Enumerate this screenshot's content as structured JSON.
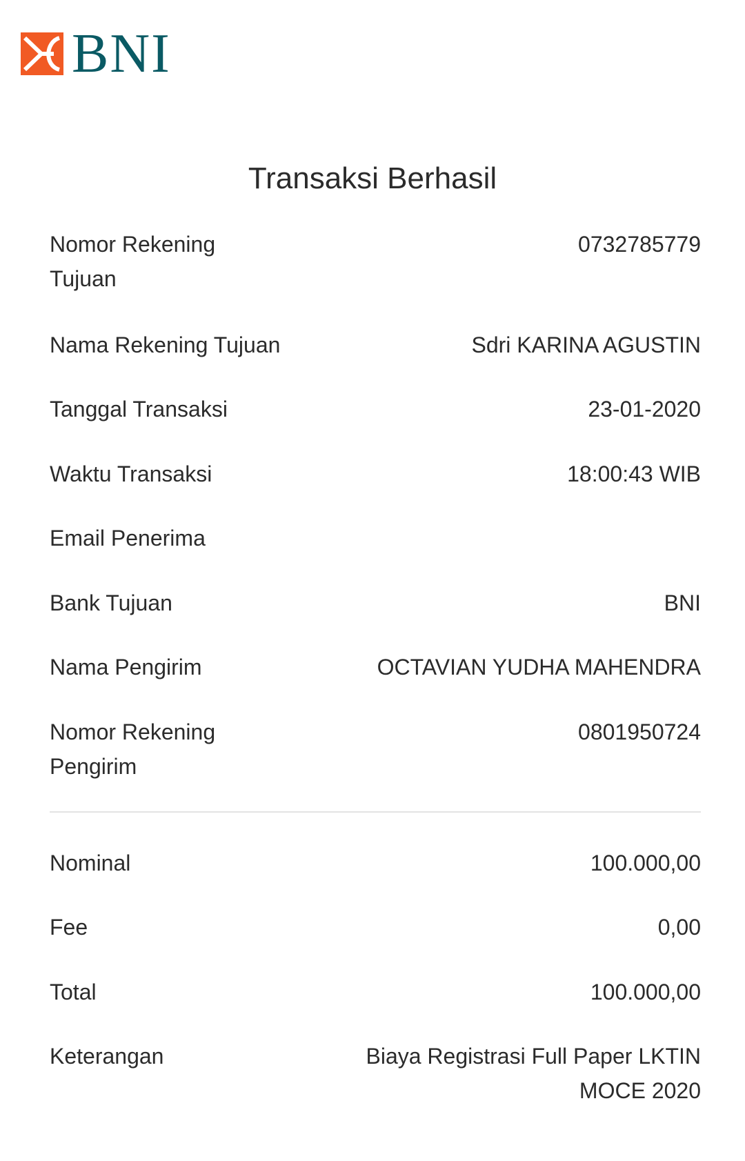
{
  "brand": {
    "name": "BNI",
    "colors": {
      "primary": "#0a5a64",
      "accent": "#f15a24"
    }
  },
  "title": "Transaksi Berhasil",
  "details": [
    {
      "label": "Nomor Rekening Tujuan",
      "value": "0732785779"
    },
    {
      "label": "Nama Rekening Tujuan",
      "value": "Sdri KARINA AGUSTIN"
    },
    {
      "label": "Tanggal Transaksi",
      "value": "23-01-2020"
    },
    {
      "label": "Waktu Transaksi",
      "value": "18:00:43 WIB"
    },
    {
      "label": "Email Penerima",
      "value": ""
    },
    {
      "label": "Bank Tujuan",
      "value": "BNI"
    },
    {
      "label": "Nama Pengirim",
      "value": "OCTAVIAN YUDHA MAHENDRA"
    },
    {
      "label": "Nomor Rekening Pengirim",
      "value": "0801950724"
    }
  ],
  "summary": [
    {
      "label": "Nominal",
      "value": "100.000,00"
    },
    {
      "label": "Fee",
      "value": "0,00"
    },
    {
      "label": "Total",
      "value": "100.000,00"
    },
    {
      "label": "Keterangan",
      "value": "Biaya Registrasi Full Paper LKTIN MOCE 2020"
    }
  ]
}
